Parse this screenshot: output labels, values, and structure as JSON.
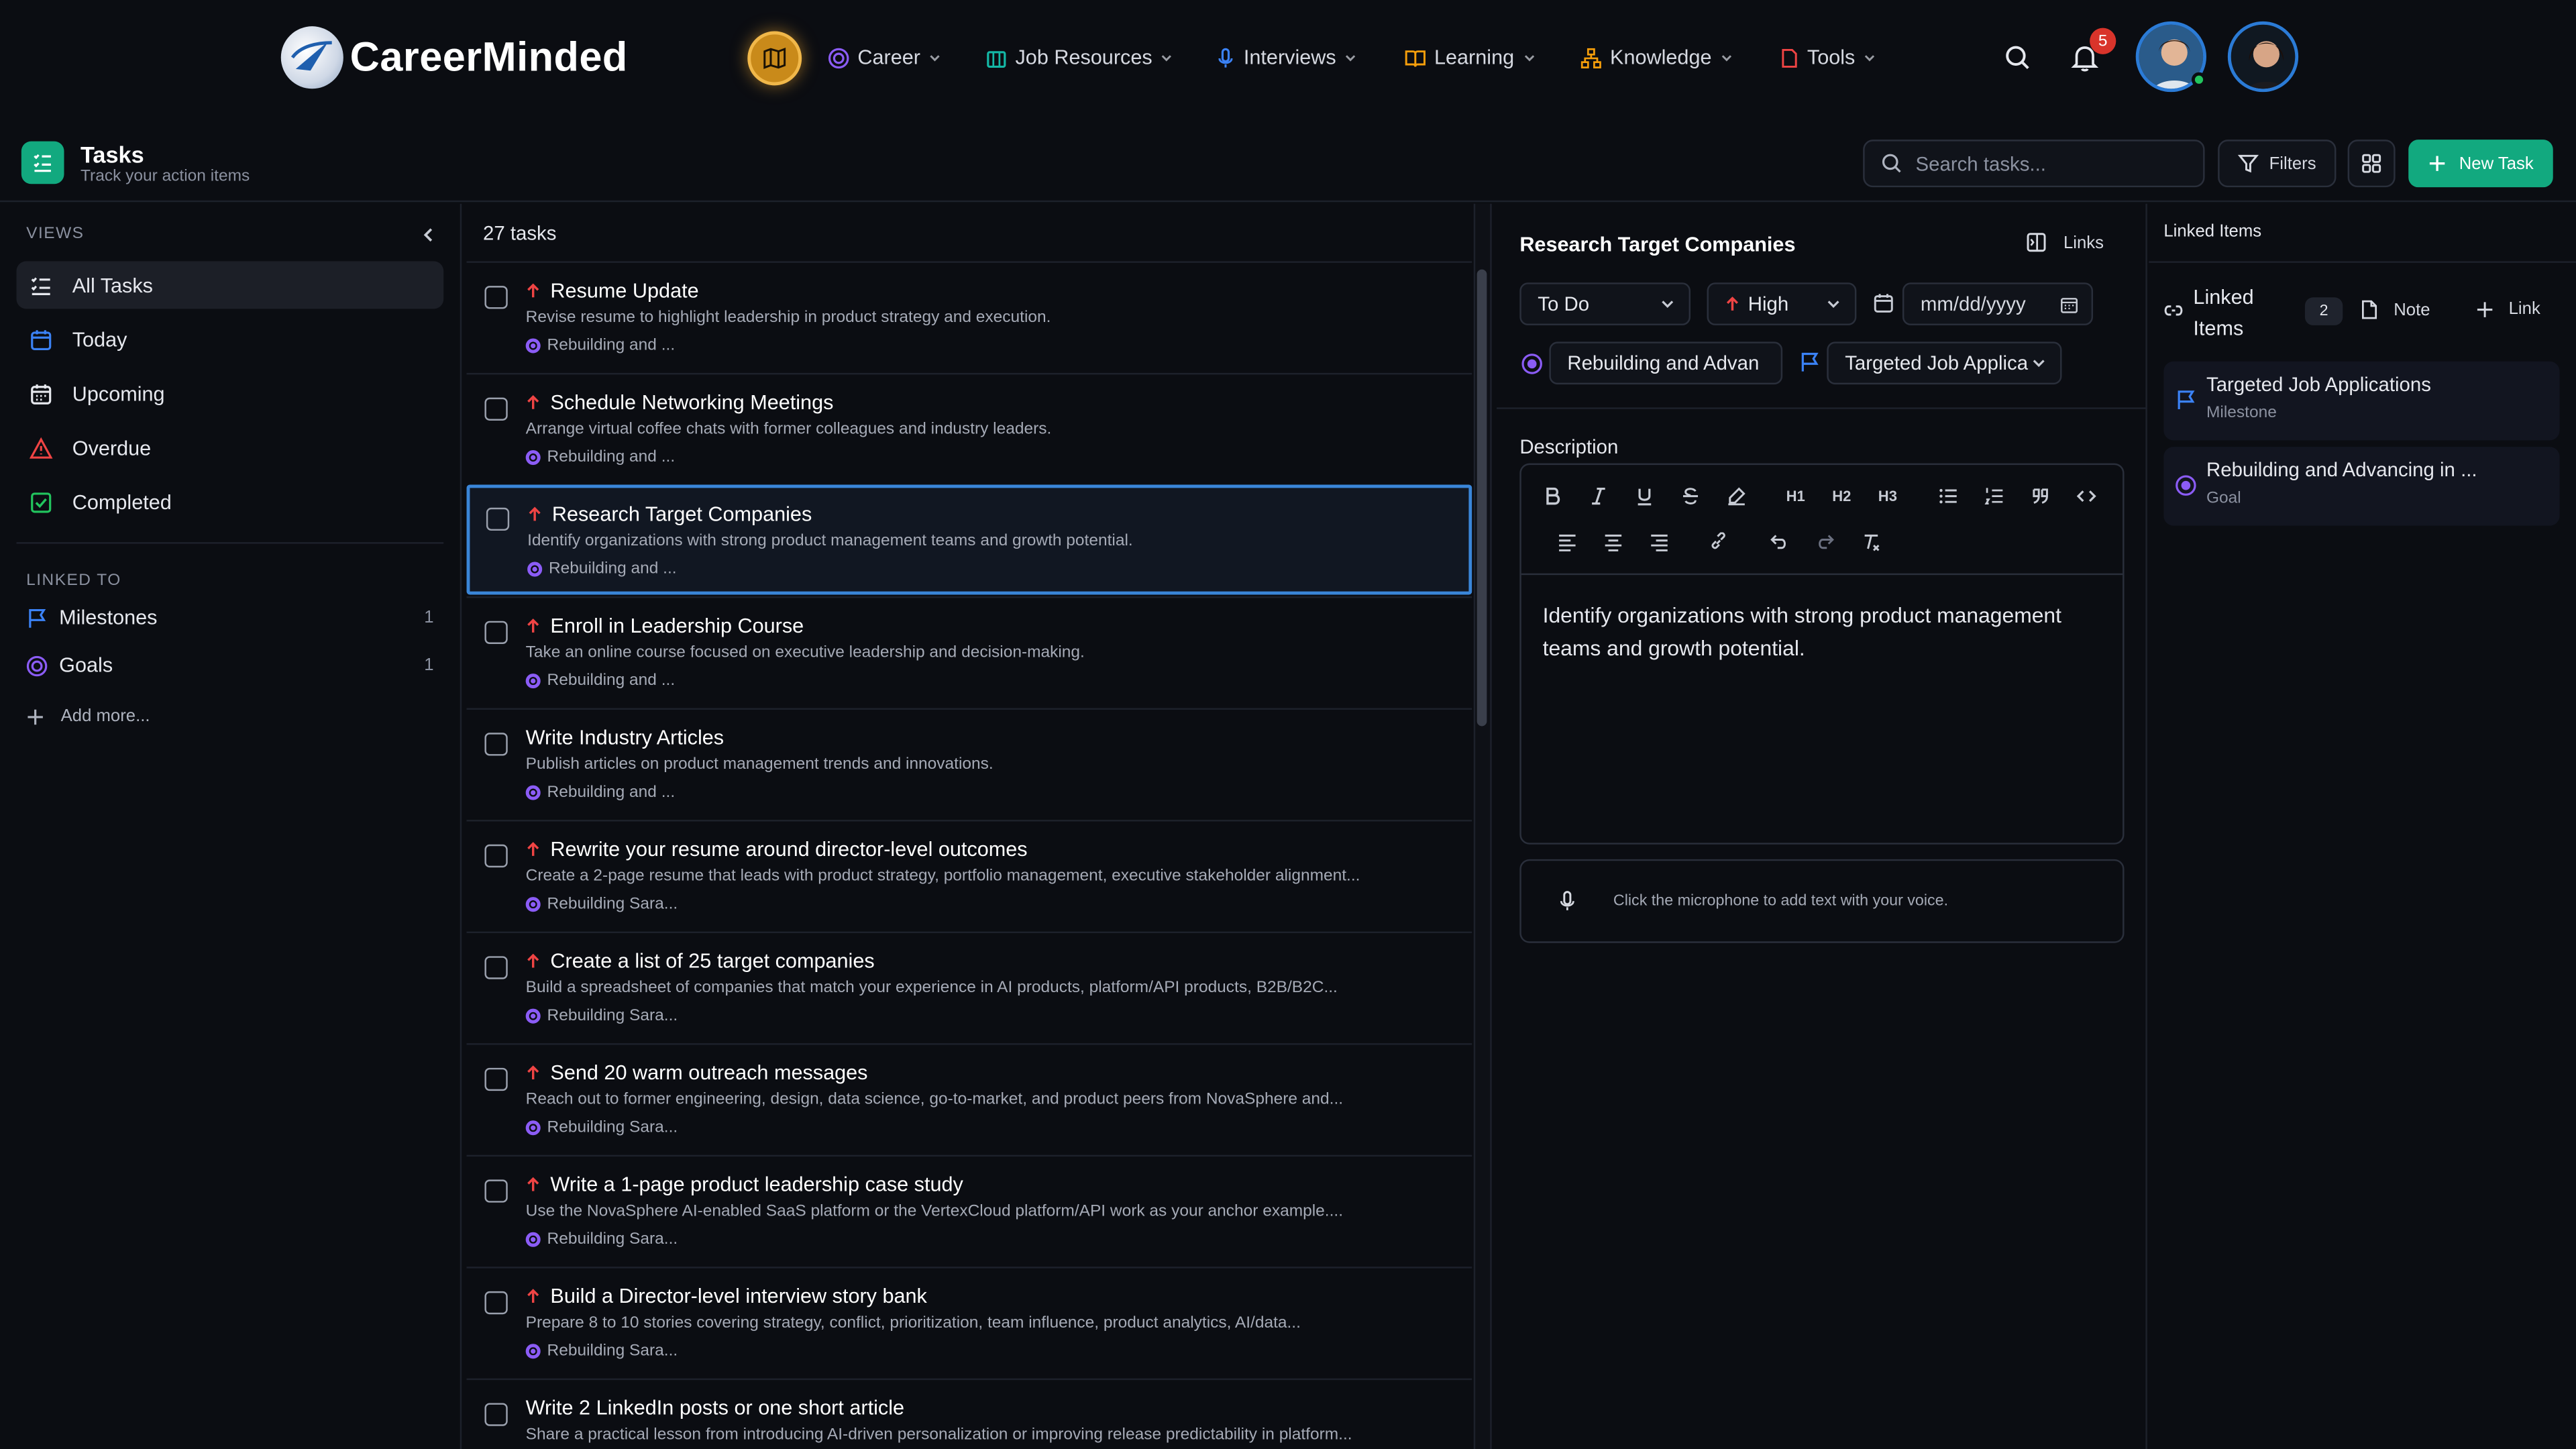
{
  "app": {
    "brand": "CareerMinded"
  },
  "nav": {
    "items": [
      {
        "label": "Career",
        "icon": "target-icon",
        "color": "#8b5cf6"
      },
      {
        "label": "Job Resources",
        "icon": "building-icon",
        "color": "#14b8a6"
      },
      {
        "label": "Interviews",
        "icon": "microphone-icon",
        "color": "#3b82f6"
      },
      {
        "label": "Learning",
        "icon": "book-icon",
        "color": "#f59e0b"
      },
      {
        "label": "Knowledge",
        "icon": "hierarchy-icon",
        "color": "#f59e0b"
      },
      {
        "label": "Tools",
        "icon": "tool-icon",
        "color": "#ef4444"
      }
    ],
    "notifications_count": "5"
  },
  "header": {
    "title": "Tasks",
    "subtitle": "Track your action items",
    "search_placeholder": "Search tasks...",
    "filters_label": "Filters",
    "new_task_label": "New Task"
  },
  "sidebar": {
    "views_label": "VIEWS",
    "views": [
      {
        "label": "All Tasks",
        "icon": "list-icon",
        "active": true
      },
      {
        "label": "Today",
        "icon": "calendar-icon",
        "color": "#3b82f6"
      },
      {
        "label": "Upcoming",
        "icon": "calendar-grid-icon"
      },
      {
        "label": "Overdue",
        "icon": "warning-icon",
        "color": "#ef4444"
      },
      {
        "label": "Completed",
        "icon": "check-square-icon",
        "color": "#22c55e"
      }
    ],
    "linked_label": "LINKED TO",
    "linked": [
      {
        "label": "Milestones",
        "count": "1",
        "icon": "flag-icon",
        "color": "#3b82f6"
      },
      {
        "label": "Goals",
        "count": "1",
        "icon": "target-icon",
        "color": "#8b5cf6"
      }
    ],
    "add_more": "Add more..."
  },
  "tasklist": {
    "count": "27 tasks",
    "tasks": [
      {
        "title": "Resume Update",
        "priority": true,
        "desc": "Revise resume to highlight leadership in product strategy and execution.",
        "goal": "Rebuilding and ..."
      },
      {
        "title": "Schedule Networking Meetings",
        "priority": true,
        "desc": "Arrange virtual coffee chats with former colleagues and industry leaders.",
        "goal": "Rebuilding and ..."
      },
      {
        "title": "Research Target Companies",
        "priority": true,
        "desc": "Identify organizations with strong product management teams and growth potential.",
        "goal": "Rebuilding and ...",
        "selected": true
      },
      {
        "title": "Enroll in Leadership Course",
        "priority": true,
        "desc": "Take an online course focused on executive leadership and decision-making.",
        "goal": "Rebuilding and ..."
      },
      {
        "title": "Write Industry Articles",
        "priority": false,
        "desc": "Publish articles on product management trends and innovations.",
        "goal": "Rebuilding and ..."
      },
      {
        "title": "Rewrite your resume around director-level outcomes",
        "priority": true,
        "desc": "Create a 2-page resume that leads with product strategy, portfolio management, executive stakeholder alignment...",
        "goal": "Rebuilding Sara..."
      },
      {
        "title": "Create a list of 25 target companies",
        "priority": true,
        "desc": "Build a spreadsheet of companies that match your experience in AI products, platform/API products, B2B/B2C...",
        "goal": "Rebuilding Sara..."
      },
      {
        "title": "Send 20 warm outreach messages",
        "priority": true,
        "desc": "Reach out to former engineering, design, data science, go-to-market, and product peers from NovaSphere and...",
        "goal": "Rebuilding Sara..."
      },
      {
        "title": "Write a 1-page product leadership case study",
        "priority": true,
        "desc": "Use the NovaSphere AI-enabled SaaS platform or the VertexCloud platform/API work as your anchor example....",
        "goal": "Rebuilding Sara..."
      },
      {
        "title": "Build a Director-level interview story bank",
        "priority": true,
        "desc": "Prepare 8 to 10 stories covering strategy, conflict, prioritization, team influence, product analytics, AI/data...",
        "goal": "Rebuilding Sara..."
      },
      {
        "title": "Write 2 LinkedIn posts or one short article",
        "priority": false,
        "desc": "Share a practical lesson from introducing AI-driven personalization or improving release predictability in platform...",
        "goal": ""
      }
    ]
  },
  "detail": {
    "title": "Research Target Companies",
    "links_label": "Links",
    "status": "To Do",
    "priority": "High",
    "date_placeholder": "mm/dd/yyyy",
    "goal_value": "Rebuilding and Advan",
    "milestone_value": "Targeted Job Applica",
    "description_label": "Description",
    "toolbar": {
      "h1": "H1",
      "h2": "H2",
      "h3": "H3"
    },
    "description_text": "Identify organizations with strong product management teams and growth potential.",
    "voice_hint": "Click the microphone to add text with your voice."
  },
  "linked_panel": {
    "header": "Linked Items",
    "section_label": "Linked Items",
    "count": "2",
    "note_label": "Note",
    "link_label": "Link",
    "items": [
      {
        "name": "Targeted Job Applications",
        "type": "Milestone",
        "icon": "flag-icon"
      },
      {
        "name": "Rebuilding and Advancing in ...",
        "type": "Goal",
        "icon": "target-icon"
      }
    ]
  },
  "colors": {
    "accent": "#12a97f",
    "selected_border": "#3a86d9",
    "priority": "#ef4444"
  }
}
